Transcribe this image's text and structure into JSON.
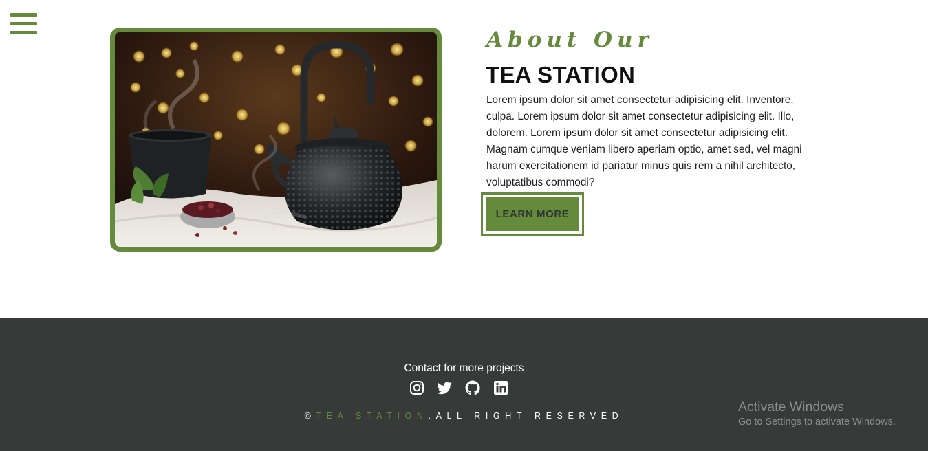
{
  "nav": {
    "menu_icon": "hamburger-menu-icon"
  },
  "about": {
    "script_heading": "About Our",
    "title": "TEA STATION",
    "paragraph": "Lorem ipsum dolor sit amet consectetur adipisicing elit. Inventore, culpa. Lorem ipsum dolor sit amet consectetur adipisicing elit. Illo, dolorem. Lorem ipsum dolor sit amet consectetur adipisicing elit. Magnam cumque veniam libero aperiam optio, amet sed, vel magni harum exercitationem id pariatur minus quis rem a nihil architecto, voluptatibus commodi?",
    "button_label": "LEARN MORE",
    "image_icon": "teapot-photo"
  },
  "footer": {
    "contact_text": "Contact for more projects",
    "socials": [
      {
        "icon": "instagram-icon"
      },
      {
        "icon": "twitter-icon"
      },
      {
        "icon": "github-icon"
      },
      {
        "icon": "linkedin-icon"
      }
    ],
    "copyright_symbol": "©",
    "copyright_brand": "TEA STATION",
    "copyright_rest": ".ALL RIGHT RESERVED"
  },
  "watermark": {
    "title": "Activate Windows",
    "subtitle": "Go to Settings to activate Windows."
  },
  "colors": {
    "accent": "#658a3c",
    "footer_bg": "#363a38",
    "text_dark": "#111111"
  }
}
